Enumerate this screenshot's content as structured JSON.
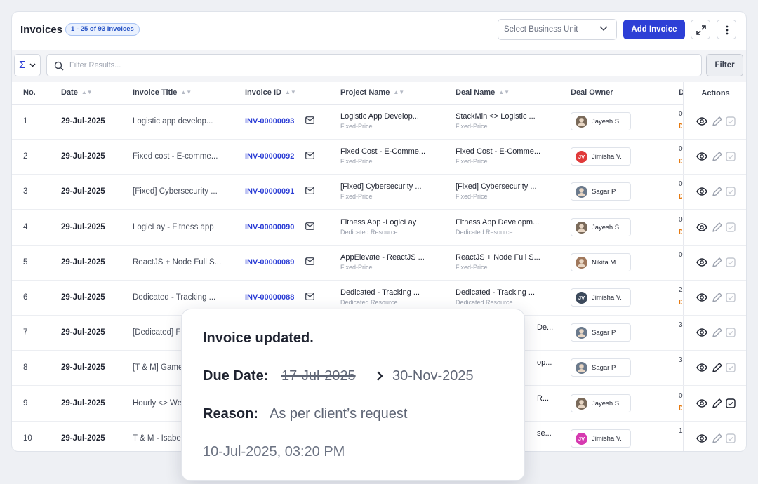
{
  "header": {
    "title": "Invoices",
    "count_badge": "1 - 25 of 93 Invoices",
    "business_unit_placeholder": "Select Business Unit",
    "add_button": "Add Invoice"
  },
  "filterbar": {
    "sigma": "Σ",
    "search_placeholder": "Filter Results...",
    "filter_button": "Filter"
  },
  "columns": {
    "no": "No.",
    "date": "Date",
    "invoice_title": "Invoice Title",
    "invoice_id": "Invoice ID",
    "project_name": "Project Name",
    "deal_name": "Deal Name",
    "deal_owner": "Deal Owner",
    "d_cut": "D",
    "actions": "Actions"
  },
  "rows": [
    {
      "no": "1",
      "date": "29-Jul-2025",
      "title": "Logistic app develop...",
      "id": "INV-00000093",
      "project": "Logistic App Develop...",
      "project_type": "Fixed-Price",
      "deal": "StackMin <> Logistic ...",
      "deal_type": "Fixed-Price",
      "owner": "Jayesh S.",
      "initials": "",
      "avatar_color": "#7a6a5a",
      "dcut1": "0",
      "dcut2": "D"
    },
    {
      "no": "2",
      "date": "29-Jul-2025",
      "title": "Fixed cost - E-comme...",
      "id": "INV-00000092",
      "project": "Fixed Cost - E-Comme...",
      "project_type": "Fixed-Price",
      "deal": "Fixed Cost - E-Comme...",
      "deal_type": "Fixed-Price",
      "owner": "Jimisha V.",
      "initials": "JV",
      "avatar_color": "#e03a3a",
      "dcut1": "0",
      "dcut2": "D"
    },
    {
      "no": "3",
      "date": "29-Jul-2025",
      "title": "[Fixed] Cybersecurity ...",
      "id": "INV-00000091",
      "project": "[Fixed] Cybersecurity ...",
      "project_type": "Fixed-Price",
      "deal": "[Fixed] Cybersecurity ...",
      "deal_type": "Fixed-Price",
      "owner": "Sagar P.",
      "initials": "",
      "avatar_color": "#6b7a8c",
      "dcut1": "0",
      "dcut2": "D"
    },
    {
      "no": "4",
      "date": "29-Jul-2025",
      "title": "LogicLay - Fitness app",
      "id": "INV-00000090",
      "project": "Fitness App -LogicLay",
      "project_type": "Dedicated Resource",
      "deal": "Fitness App Developm...",
      "deal_type": "Dedicated Resource",
      "owner": "Jayesh S.",
      "initials": "",
      "avatar_color": "#7a6a5a",
      "dcut1": "0",
      "dcut2": "D"
    },
    {
      "no": "5",
      "date": "29-Jul-2025",
      "title": "ReactJS + Node Full S...",
      "id": "INV-00000089",
      "project": "AppElevate - ReactJS ...",
      "project_type": "Fixed-Price",
      "deal": "ReactJS + Node Full S...",
      "deal_type": "Fixed-Price",
      "owner": "Nikita M.",
      "initials": "",
      "avatar_color": "#a0785c",
      "dcut1": "0",
      "dcut2": ""
    },
    {
      "no": "6",
      "date": "29-Jul-2025",
      "title": "Dedicated - Tracking ...",
      "id": "INV-00000088",
      "project": "Dedicated - Tracking ...",
      "project_type": "Dedicated Resource",
      "deal": "Dedicated - Tracking ...",
      "deal_type": "Dedicated Resource",
      "owner": "Jimisha V.",
      "initials": "JV",
      "avatar_color": "#3d4a5c",
      "dcut1": "2",
      "dcut2": "D"
    },
    {
      "no": "7",
      "date": "29-Jul-2025",
      "title": "[Dedicated] F",
      "id": "",
      "project": "",
      "project_type": "",
      "deal": "De...",
      "deal_type": "",
      "owner": "Sagar P.",
      "initials": "",
      "avatar_color": "#6b7a8c",
      "dcut1": "3",
      "dcut2": ""
    },
    {
      "no": "8",
      "date": "29-Jul-2025",
      "title": "[T & M] Game",
      "id": "",
      "project": "",
      "project_type": "",
      "deal": "op...",
      "deal_type": "",
      "owner": "Sagar P.",
      "initials": "",
      "avatar_color": "#6b7a8c",
      "dcut1": "3",
      "dcut2": ""
    },
    {
      "no": "9",
      "date": "29-Jul-2025",
      "title": "Hourly <> We",
      "id": "",
      "project": "",
      "project_type": "",
      "deal": "R...",
      "deal_type": "",
      "owner": "Jayesh S.",
      "initials": "",
      "avatar_color": "#7a6a5a",
      "dcut1": "0",
      "dcut2": "D"
    },
    {
      "no": "10",
      "date": "29-Jul-2025",
      "title": "T & M - Isabe",
      "id": "",
      "project": "",
      "project_type": "",
      "deal": "se...",
      "deal_type": "",
      "owner": "Jimisha V.",
      "initials": "JV",
      "avatar_color": "#d63ab0",
      "dcut1": "1",
      "dcut2": ""
    }
  ],
  "toast": {
    "title": "Invoice updated.",
    "due_label": "Due Date:",
    "old_date": "17-Jul-2025",
    "new_date": "30-Nov-2025",
    "reason_label": "Reason:",
    "reason": "As per client’s request",
    "timestamp": "10-Jul-2025, 03:20 PM"
  },
  "colors": {
    "accent": "#2d3fd6",
    "warning": "#e57a12"
  }
}
